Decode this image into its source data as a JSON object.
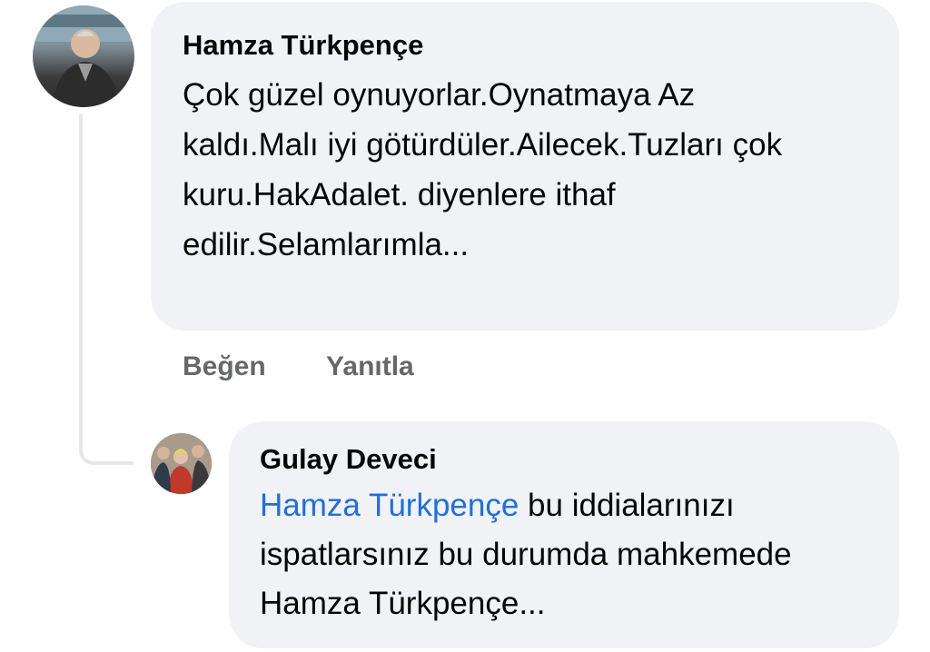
{
  "comment": {
    "author": "Hamza Türkpençe",
    "text": "Çok güzel oynuyorlar.Oynatmaya Az kaldı.Malı iyi götürdüler.Ailecek.Tuzları çok kuru.HakAdalet. diyenlere ithaf edilir.Selamlarımla...",
    "actions": {
      "like": "Beğen",
      "reply": "Yanıtla"
    }
  },
  "reply": {
    "author": "Gulay Deveci",
    "mention": "Hamza Türkpençe",
    "text": " bu iddialarınızı ispatlarsınız bu durumda mahkemede Hamza Türkpençe..."
  },
  "colors": {
    "bubble": "#f0f2f5",
    "mention": "#216fdb",
    "action_text": "#65676b"
  }
}
